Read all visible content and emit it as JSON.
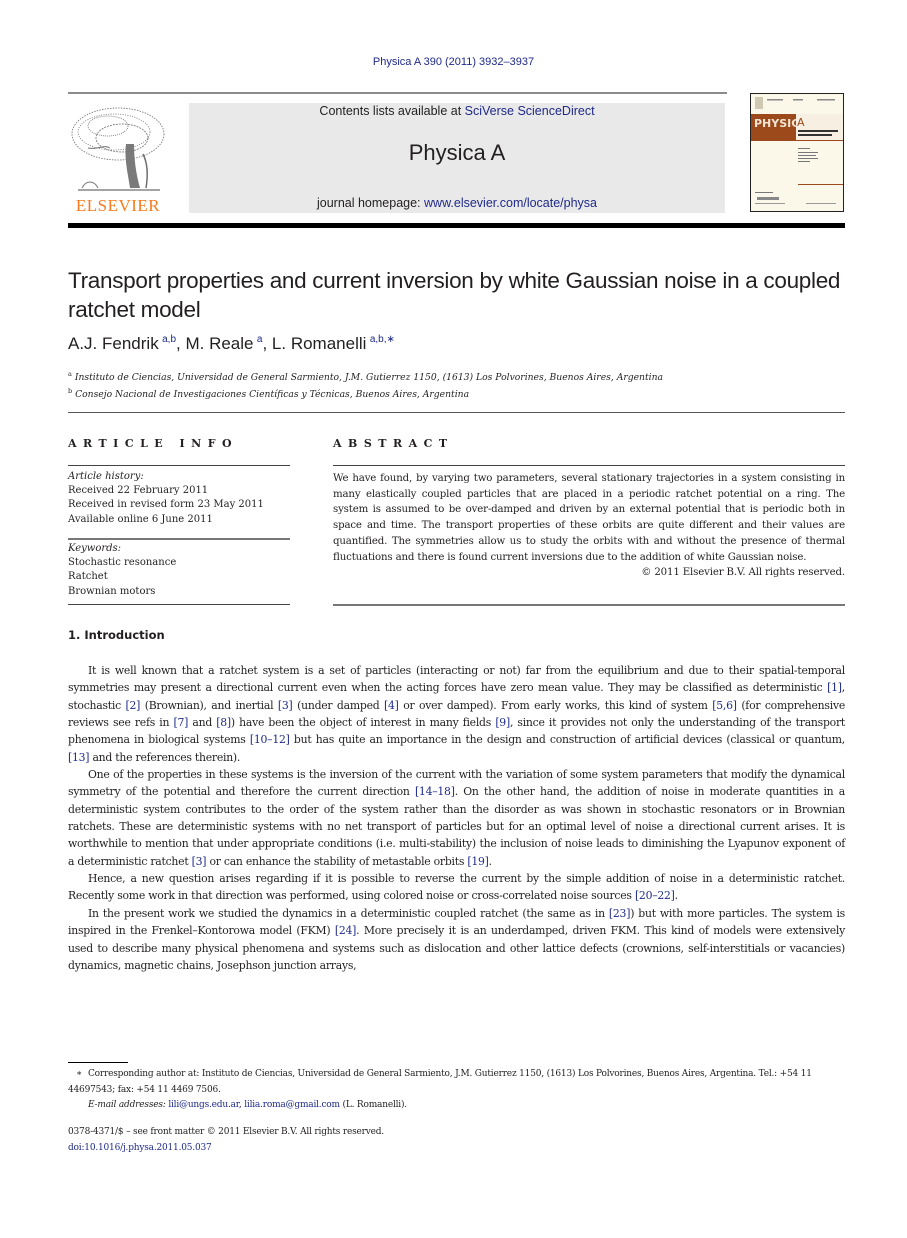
{
  "running_header": "Physica A 390 (2011) 3932–3937",
  "masthead": {
    "publisher_logo_text": "ELSEVIER",
    "contents_prefix": "Contents lists available at ",
    "contents_link": "SciVerse ScienceDirect",
    "journal_name": "Physica A",
    "homepage_prefix": "journal homepage: ",
    "homepage_link": "www.elsevier.com/locate/physa",
    "cover_title": "PHYSICA",
    "cover_letter": "A",
    "colors": {
      "logo_orange": "#f47b20",
      "link_blue": "#1f2a8a",
      "cover_brown": "#9c4a1c"
    }
  },
  "article": {
    "title": "Transport properties and current inversion by white Gaussian noise in a coupled ratchet model",
    "authors": [
      {
        "name": "A.J. Fendrik",
        "sup": "a,b"
      },
      {
        "name": "M. Reale",
        "sup": "a"
      },
      {
        "name": "L. Romanelli",
        "sup": "a,b,∗"
      }
    ],
    "affiliations": [
      {
        "mark": "a",
        "text": "Instituto de Ciencias, Universidad de General Sarmiento, J.M. Gutierrez 1150, (1613) Los Polvorines, Buenos Aires, Argentina"
      },
      {
        "mark": "b",
        "text": "Consejo Nacional de Investigaciones Científicas y Técnicas, Buenos Aires, Argentina"
      }
    ]
  },
  "article_info": {
    "heading": "ARTICLE INFO",
    "history_label": "Article history:",
    "history": [
      "Received 22 February 2011",
      "Received in revised form 23 May 2011",
      "Available online 6 June 2011"
    ],
    "keywords_label": "Keywords:",
    "keywords": [
      "Stochastic resonance",
      "Ratchet",
      "Brownian motors"
    ]
  },
  "abstract": {
    "heading": "ABSTRACT",
    "text": "We have found, by varying two parameters, several stationary trajectories in a system consisting in many elastically coupled particles that are placed in a periodic ratchet potential on a ring. The system is assumed to be over-damped and driven by an external potential that is periodic both in space and time. The transport properties of these orbits are quite different and their values are quantified. The symmetries allow us to study the orbits with and without the presence of thermal fluctuations and there is found current inversions due to the addition of white Gaussian noise.",
    "copyright": "© 2011 Elsevier B.V. All rights reserved."
  },
  "introduction": {
    "heading": "1.  Introduction",
    "paragraphs": [
      [
        {
          "t": "It is well known that a ratchet system is a set of particles (interacting or not) far from the equilibrium and due to their spatial-temporal symmetries may present a directional current even when the acting forces have zero mean value. They may be classified as deterministic "
        },
        {
          "c": "[1]"
        },
        {
          "t": ", stochastic "
        },
        {
          "c": "[2]"
        },
        {
          "t": " (Brownian), and inertial "
        },
        {
          "c": "[3]"
        },
        {
          "t": " (under damped "
        },
        {
          "c": "[4]"
        },
        {
          "t": " or over damped). From early works, this kind of system "
        },
        {
          "c": "[5,6]"
        },
        {
          "t": " (for comprehensive reviews see refs in "
        },
        {
          "c": "[7]"
        },
        {
          "t": " and "
        },
        {
          "c": "[8]"
        },
        {
          "t": ") have been the object of interest in many fields "
        },
        {
          "c": "[9]"
        },
        {
          "t": ", since it provides not only the understanding of the transport phenomena in biological systems "
        },
        {
          "c": "[10–12]"
        },
        {
          "t": " but has quite an importance in the design and construction of artificial devices (classical or quantum, "
        },
        {
          "c": "[13]"
        },
        {
          "t": " and the references therein)."
        }
      ],
      [
        {
          "t": "One of the properties in these systems is the inversion of the current with the variation of some system parameters that modify the dynamical symmetry of the potential and therefore the current direction "
        },
        {
          "c": "[14–18]"
        },
        {
          "t": ". On the other hand, the addition of noise in moderate quantities in a deterministic system contributes to the order of the system rather than the disorder as was shown in stochastic resonators or in Brownian ratchets. These are deterministic systems with no net transport of particles but for an optimal level of noise a directional current arises. It is worthwhile to mention that under appropriate conditions (i.e. multi-stability) the inclusion of noise leads to diminishing the Lyapunov exponent of a deterministic ratchet "
        },
        {
          "c": "[3]"
        },
        {
          "t": " or can enhance the stability of metastable orbits "
        },
        {
          "c": "[19]"
        },
        {
          "t": "."
        }
      ],
      [
        {
          "t": "Hence, a new question arises regarding if it is possible to reverse the current by the simple addition of noise in a deterministic ratchet. Recently some work in that direction was performed, using colored noise or cross-correlated noise sources "
        },
        {
          "c": "[20–22]"
        },
        {
          "t": "."
        }
      ],
      [
        {
          "t": "In the present work we studied the dynamics in a deterministic coupled ratchet (the same as in "
        },
        {
          "c": "[23]"
        },
        {
          "t": ") but with more particles. The system is inspired in the Frenkel–Kontorowa model (FKM) "
        },
        {
          "c": "[24]"
        },
        {
          "t": ". More precisely it is an underdamped, driven FKM. This kind of models were extensively used to describe many physical phenomena and systems such as dislocation and other lattice defects (crownions, self-interstitials or vacancies) dynamics, magnetic chains, Josephson junction arrays,"
        }
      ]
    ]
  },
  "footnotes": {
    "star": "∗",
    "corresponding": "Corresponding author at: Instituto de Ciencias, Universidad de General Sarmiento, J.M. Gutierrez 1150, (1613) Los Polvorines, Buenos Aires, Argentina. Tel.: +54 11 44697543; fax: +54 11 4469 7506.",
    "email_label": "E-mail addresses:",
    "emails": [
      "lili@ungs.edu.ar",
      "lilia.roma@gmail.com"
    ],
    "email_suffix": " (L. Romanelli).",
    "front_matter": "0378-4371/$ – see front matter © 2011 Elsevier B.V. All rights reserved.",
    "doi": "doi:10.1016/j.physa.2011.05.037"
  }
}
